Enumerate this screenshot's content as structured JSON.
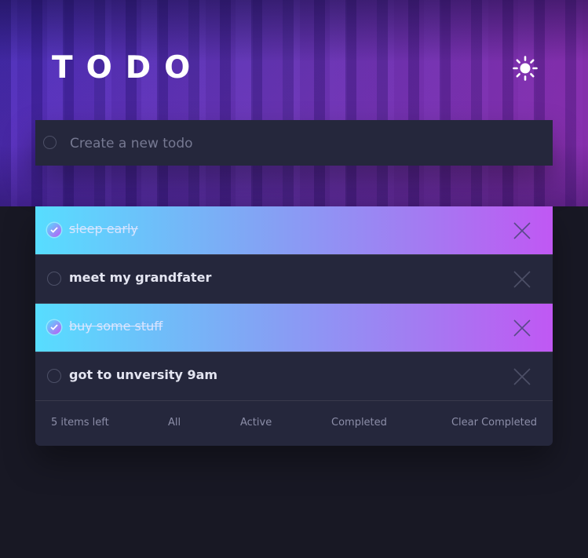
{
  "header": {
    "title": "TODO",
    "theme_icon": "sun-icon"
  },
  "new_todo": {
    "placeholder": "Create a new todo",
    "value": ""
  },
  "todos": [
    {
      "text": "sleep early",
      "completed": true
    },
    {
      "text": "meet my grandfater",
      "completed": false
    },
    {
      "text": "buy some stuff",
      "completed": true
    },
    {
      "text": "got to unversity 9am",
      "completed": false
    }
  ],
  "footer": {
    "items_left": "5 items left",
    "filter_all": "All",
    "filter_active": "Active",
    "filter_completed": "Completed",
    "clear_completed": "Clear Completed"
  },
  "colors": {
    "background": "#181824",
    "card": "#25273c",
    "gradient_start": "#57ddff",
    "gradient_end": "#c058f3"
  }
}
